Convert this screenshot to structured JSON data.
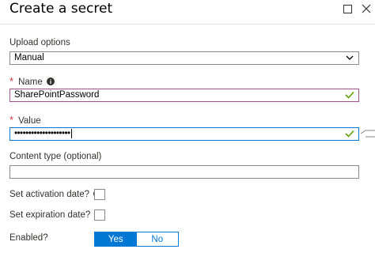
{
  "header": {
    "title": "Create a secret"
  },
  "upload_options": {
    "label": "Upload options",
    "value": "Manual"
  },
  "name_field": {
    "required_marker": "*",
    "label": "Name",
    "value": "SharePointPassword"
  },
  "value_field": {
    "required_marker": "*",
    "label": "Value",
    "masked_value": "••••••••••••••••••••"
  },
  "content_type": {
    "label": "Content type (optional)",
    "value": ""
  },
  "activation": {
    "label": "Set activation date?",
    "checked": false
  },
  "expiration": {
    "label": "Set expiration date?",
    "checked": false
  },
  "enabled": {
    "label": "Enabled?",
    "options": [
      "Yes",
      "No"
    ],
    "selected": "Yes"
  },
  "colors": {
    "accent": "#0078d4",
    "required": "#d13438",
    "success": "#57a300",
    "name_border": "#a4508b"
  }
}
